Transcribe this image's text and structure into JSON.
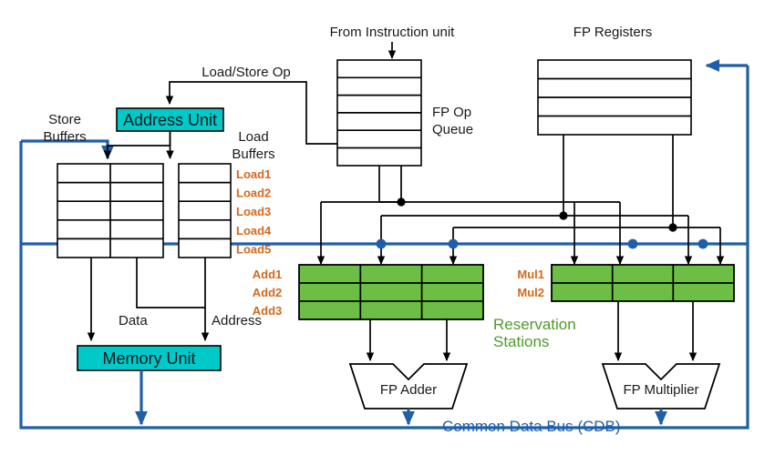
{
  "diagram": {
    "title": "Tomasulo Architecture Block Diagram",
    "colors": {
      "teal_unit": "#00c9c9",
      "reservation_station_green": "#6cbe45",
      "cdb_blue": "#1f5fa8",
      "rs_label_orange": "#d2691e",
      "rs_text_green": "#4f9a2a",
      "box_stroke": "#000000"
    }
  },
  "labels": {
    "from_instruction_unit": "From Instruction unit",
    "fp_registers": "FP Registers",
    "load_store_op": "Load/Store Op",
    "store_buffers": "Store\nBuffers",
    "store_buffers_line1": "Store",
    "store_buffers_line2": "Buffers",
    "load_buffers_line1": "Load",
    "load_buffers_line2": "Buffers",
    "fp_op_queue_line1": "FP Op",
    "fp_op_queue_line2": "Queue",
    "address_unit": "Address Unit",
    "memory_unit": "Memory Unit",
    "data": "Data",
    "address": "Address",
    "reservation_stations_line1": "Reservation",
    "reservation_stations_line2": "Stations",
    "fp_adder": "FP Adder",
    "fp_multiplier": "FP Multiplier",
    "common_data_bus": "Common Data Bus (CDB)"
  },
  "load_buffer_entries": [
    "Load1",
    "Load2",
    "Load3",
    "Load4",
    "Load5"
  ],
  "add_station_entries": [
    "Add1",
    "Add2",
    "Add3"
  ],
  "mul_station_entries": [
    "Mul1",
    "Mul2"
  ],
  "structures": {
    "fp_op_queue": {
      "rows": 6,
      "cols": 1
    },
    "fp_registers": {
      "rows": 4,
      "cols": 1
    },
    "store_buffers": {
      "rows": 5,
      "cols": 2
    },
    "load_buffers": {
      "rows": 5,
      "cols": 1
    },
    "add_reservation_stations": {
      "rows": 3,
      "cols": 3
    },
    "mul_reservation_stations": {
      "rows": 2,
      "cols": 3
    }
  }
}
